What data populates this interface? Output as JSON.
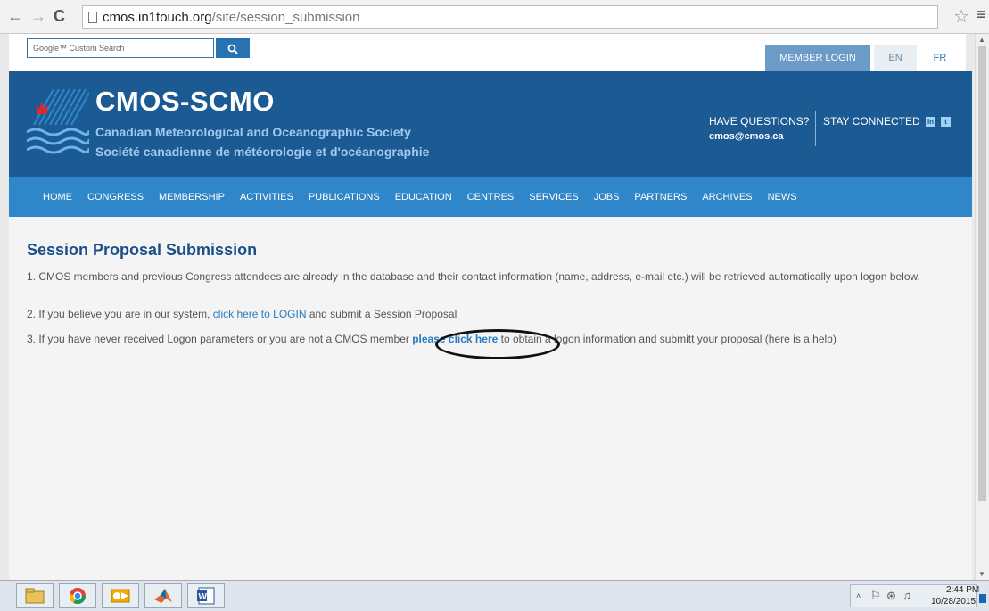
{
  "browser": {
    "url_domain": "cmos.in1touch.org",
    "url_path": "/site/session_submission",
    "back_glyph": "←",
    "forward_glyph": "→",
    "reload_glyph": "C",
    "star_glyph": "☆",
    "menu_glyph": "≡"
  },
  "topbar": {
    "search_placeholder": "Google™ Custom Search",
    "search_icon": "search-icon",
    "member_login": "MEMBER LOGIN",
    "lang_en": "EN",
    "lang_fr": "FR"
  },
  "header": {
    "title": "CMOS-SCMO",
    "subtitle_en": "Canadian Meteorological and Oceanographic Society",
    "subtitle_fr": "Société canadienne de météorologie et d'océanographie",
    "have_questions": "HAVE QUESTIONS?",
    "email": "cmos@cmos.ca",
    "stay_connected": "STAY CONNECTED",
    "social": [
      "in",
      "t"
    ]
  },
  "nav": [
    "HOME",
    "CONGRESS",
    "MEMBERSHIP",
    "ACTIVITIES",
    "PUBLICATIONS",
    "EDUCATION",
    "CENTRES",
    "SERVICES",
    "JOBS",
    "PARTNERS",
    "ARCHIVES",
    "NEWS"
  ],
  "content": {
    "title": "Session Proposal Submission",
    "p1": "1. CMOS members and previous Congress attendees are already in the database and their contact information (name, address, e-mail etc.) will be retrieved automatically upon logon below.",
    "p2_pre": "2. If you believe you are in our system, ",
    "p2_link": "click here to LOGIN",
    "p2_post": "  and submit a Session Proposal",
    "p3_pre": "3. If you have never received Logon parameters or you are not a CMOS member ",
    "p3_link": "please click here",
    "p3_post": " to obtain a logon information and submitt your proposal (here is a help)"
  },
  "taskbar": {
    "time": "2:44 PM",
    "date": "10/28/2015",
    "apps": [
      "file-explorer-icon",
      "chrome-icon",
      "outlook-icon",
      "matlab-icon",
      "word-icon"
    ]
  },
  "colors": {
    "header_blue": "#1c5a93",
    "nav_blue": "#2f86c8",
    "link_blue": "#2a7abf",
    "title_blue": "#1a4f88"
  }
}
